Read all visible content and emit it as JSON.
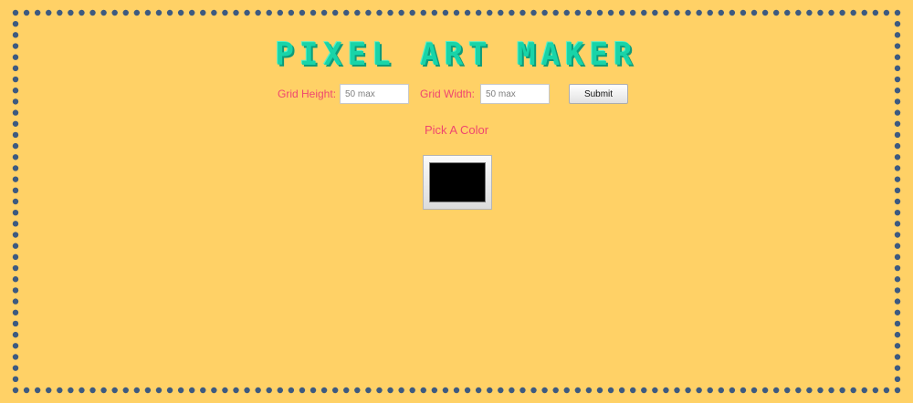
{
  "app": {
    "title": "PIXEL ART MAKER"
  },
  "form": {
    "height_label": "Grid Height:",
    "height_placeholder": "50 max",
    "width_label": "Grid Width:",
    "width_placeholder": "50 max",
    "submit_label": "Submit"
  },
  "color": {
    "pick_label": "Pick A Color",
    "selected": "#000000"
  },
  "theme": {
    "background": "#ffd166",
    "dot_border": "#3d5a80",
    "title_color": "#18d4a8",
    "label_color": "#ef476f"
  }
}
